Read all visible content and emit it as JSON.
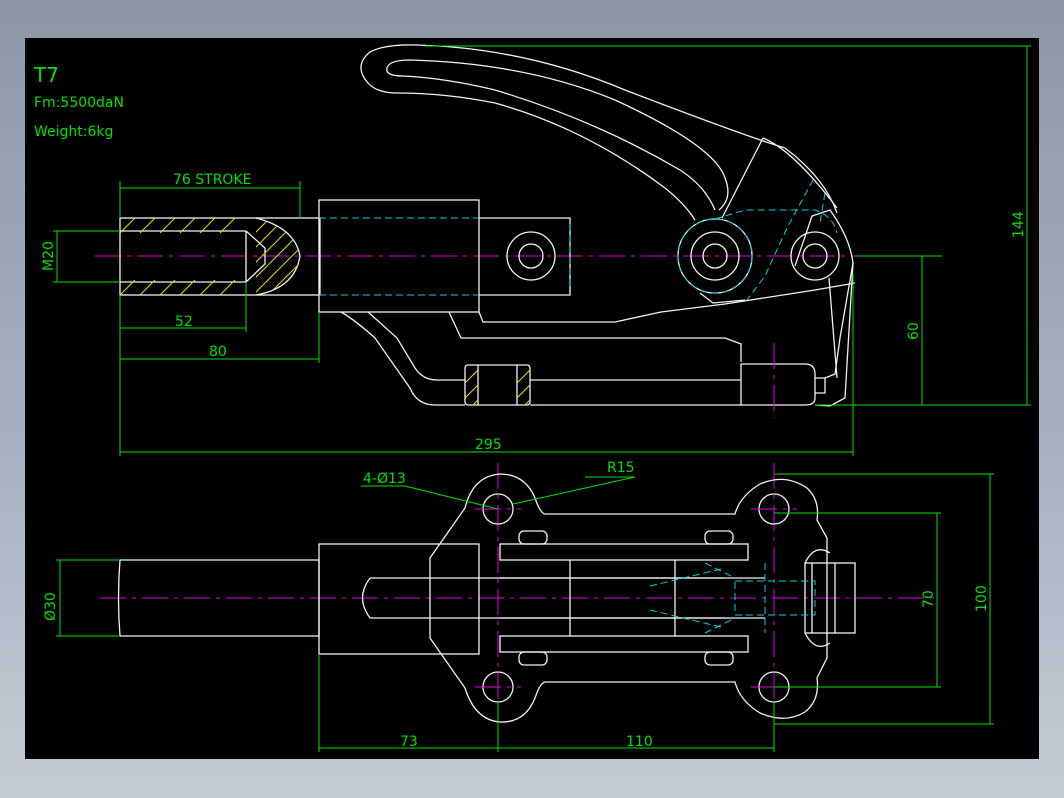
{
  "title": "T7",
  "force": "Fm:5500daN",
  "weight": "Weight:6kg",
  "dimensions": {
    "stroke": "76 STROKE",
    "thread": "M20",
    "thread_length": "52",
    "plunger_length": "80",
    "overall_length": "295",
    "height": "144",
    "axis_height": "60",
    "plunger_dia": "Ø30",
    "holes": "4-Ø13",
    "radius": "R15",
    "hole_offset": "73",
    "hole_spacing": "110",
    "inner_width": "70",
    "outer_width": "100"
  },
  "colors": {
    "outline": "#f2f2f2",
    "dimension": "#00e000",
    "centerline": "#e000e0",
    "hidden": "#00d0e0",
    "hatch": "#e8e000"
  }
}
